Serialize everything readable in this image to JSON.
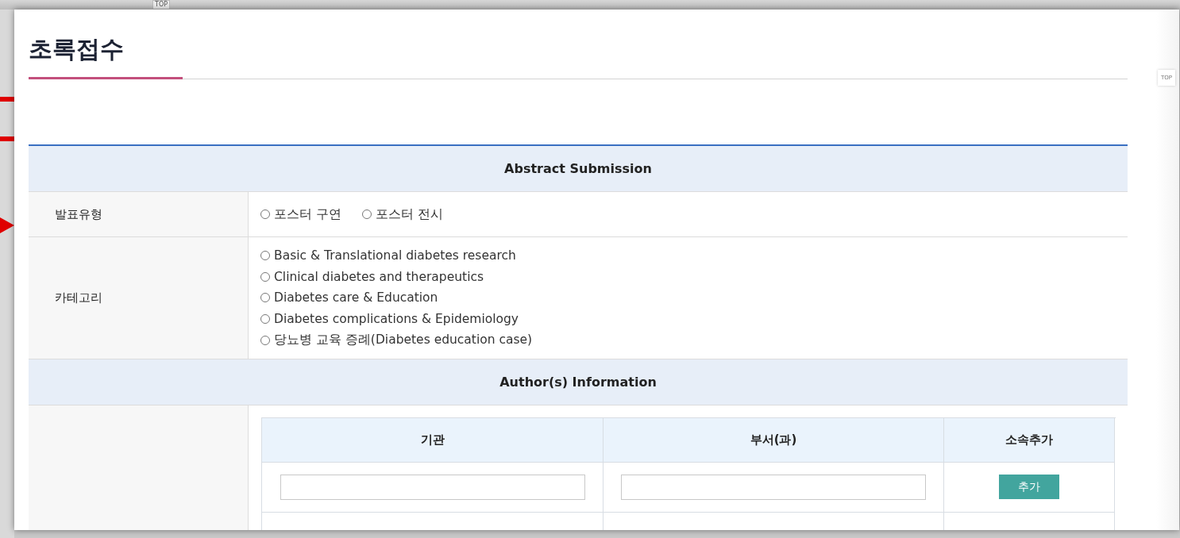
{
  "background": {
    "top_button": "TOP"
  },
  "popup": {
    "title": "초록접수",
    "top_button": "TOP",
    "sections": [
      {
        "heading": "Abstract Submission",
        "rows": [
          {
            "label": "발표유형",
            "kind": "inline",
            "options": [
              {
                "label": "포스터 구연",
                "selected": false
              },
              {
                "label": "포스터 전시",
                "selected": false
              }
            ]
          },
          {
            "label": "카테고리",
            "kind": "stacked",
            "options": [
              {
                "label": "Basic & Translational diabetes research",
                "selected": false
              },
              {
                "label": "Clinical diabetes and therapeutics",
                "selected": false
              },
              {
                "label": "Diabetes care & Education",
                "selected": false
              },
              {
                "label": "Diabetes complications & Epidemiology",
                "selected": false
              },
              {
                "label": "당뇨병 교육 증례(Diabetes education case)",
                "selected": false
              }
            ]
          }
        ]
      },
      {
        "heading": "Author(s) Information",
        "affiliation_table": {
          "columns": [
            "기관",
            "부서(과)",
            "소속추가"
          ],
          "add_button": "추가"
        }
      }
    ]
  }
}
